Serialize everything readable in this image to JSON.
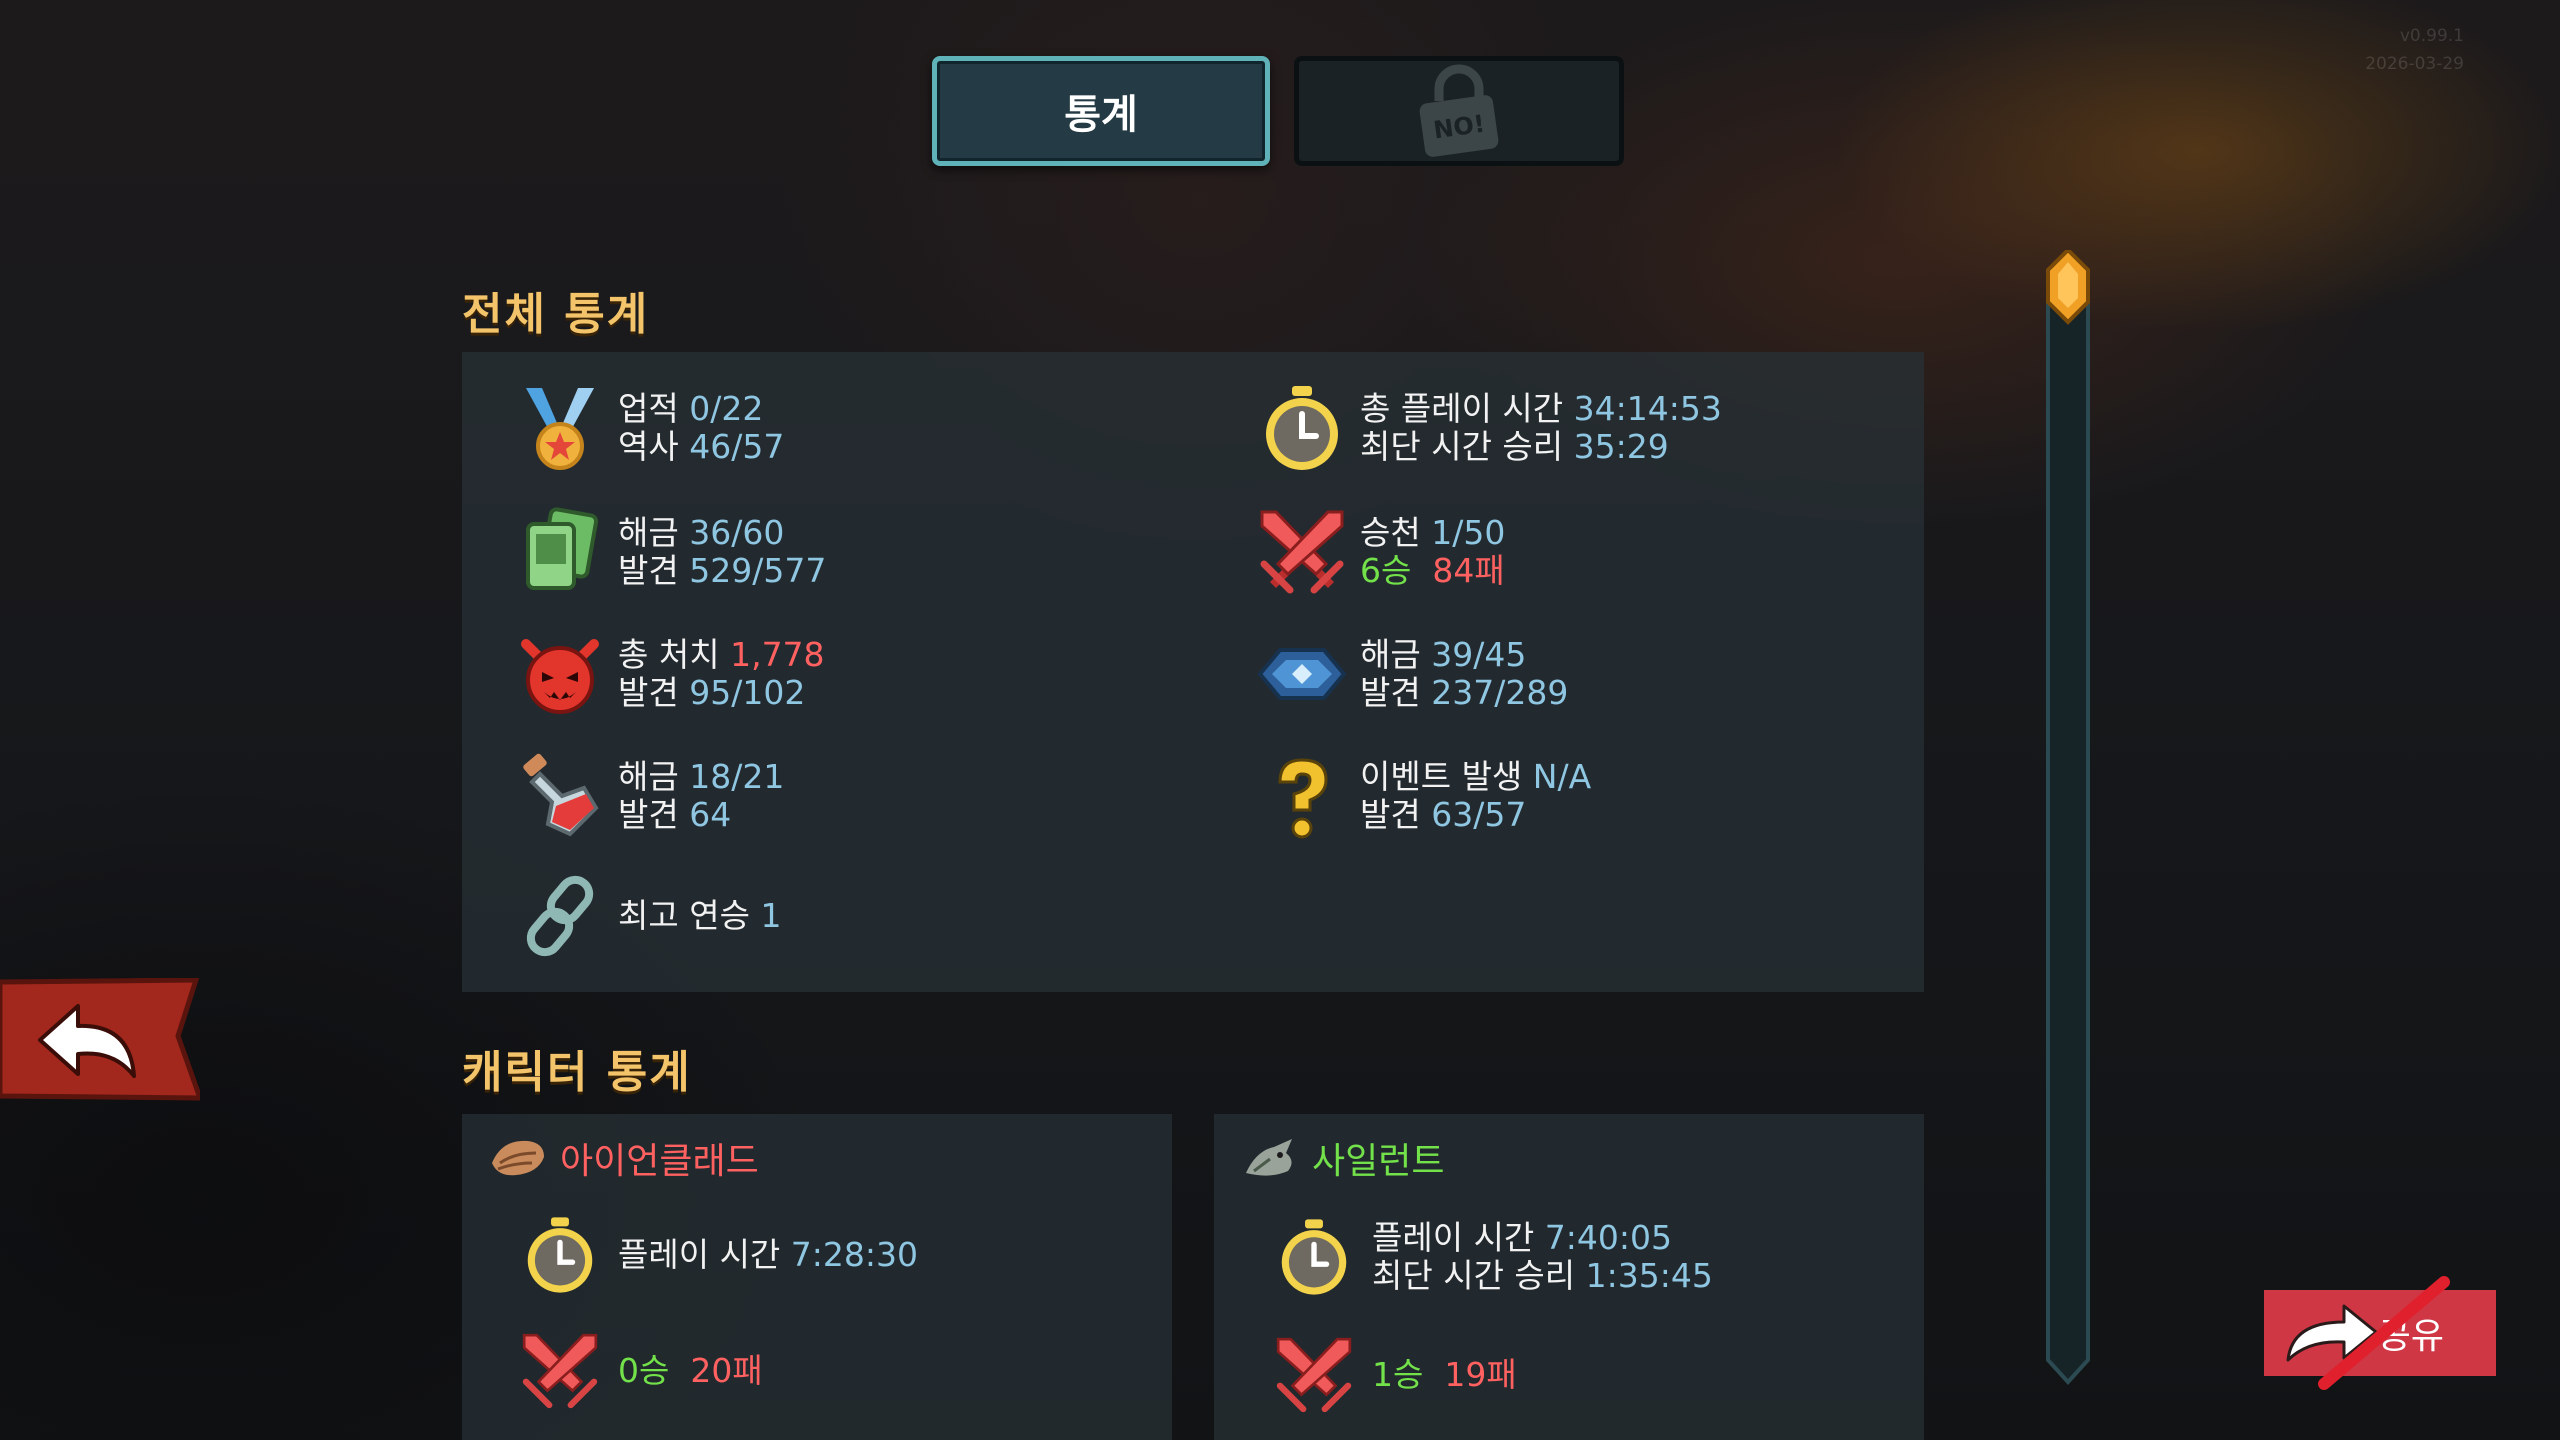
{
  "version": {
    "build": "v0.99.1",
    "date": "2026-03-29"
  },
  "tabs": {
    "stats": "통계",
    "locked_badge": "NO!"
  },
  "overall": {
    "title": "전체 통계",
    "achievements": {
      "label": "업적",
      "value": "0/22"
    },
    "history": {
      "label": "역사",
      "value": "46/57"
    },
    "cards_unlocked": {
      "label": "해금",
      "value": "36/60"
    },
    "cards_discovered": {
      "label": "발견",
      "value": "529/577"
    },
    "total_kills": {
      "label": "총 처치",
      "value": "1,778"
    },
    "monsters_discovered": {
      "label": "발견",
      "value": "95/102"
    },
    "potions_unlocked": {
      "label": "해금",
      "value": "18/21"
    },
    "potions_discovered": {
      "label": "발견",
      "value": "64"
    },
    "best_streak": {
      "label": "최고 연승",
      "value": "1"
    },
    "total_playtime": {
      "label": "총 플레이 시간",
      "value": "34:14:53"
    },
    "fastest_win": {
      "label": "최단 시간 승리",
      "value": "35:29"
    },
    "ascension": {
      "label": "승천",
      "value": "1/50"
    },
    "wins": "6승",
    "losses": "84패",
    "relics_unlocked": {
      "label": "해금",
      "value": "39/45"
    },
    "relics_discovered": {
      "label": "발견",
      "value": "237/289"
    },
    "events_seen": {
      "label": "이벤트 발생",
      "value": "N/A"
    },
    "events_discovered": {
      "label": "발견",
      "value": "63/57"
    }
  },
  "character_stats": {
    "title": "캐릭터 통계",
    "ironclad": {
      "name": "아이언클래드",
      "playtime": {
        "label": "플레이 시간",
        "value": "7:28:30"
      },
      "wins": "0승",
      "losses": "20패"
    },
    "silent": {
      "name": "사일런트",
      "playtime": {
        "label": "플레이 시간",
        "value": "7:40:05"
      },
      "fastest_win": {
        "label": "최단 시간 승리",
        "value": "1:35:45"
      },
      "wins": "1승",
      "losses": "19패"
    }
  },
  "share_button": "공유",
  "icons": [
    "medal-icon",
    "stopwatch-icon",
    "cards-icon",
    "crossed-swords-icon",
    "demon-icon",
    "relic-icon",
    "potion-icon",
    "question-icon",
    "chain-icon",
    "ironclad-icon",
    "silent-icon",
    "back-arrow-icon",
    "share-arrow-icon",
    "padlock-icon"
  ],
  "colors": {
    "title": "#f3c46a",
    "value": "#8fc6e2",
    "win": "#73e24a",
    "loss": "#ff6161",
    "ironclad": "#ff6161",
    "silent": "#73e24a",
    "tab_border": "#5fb2b7",
    "share_bg": "#cf3745"
  }
}
